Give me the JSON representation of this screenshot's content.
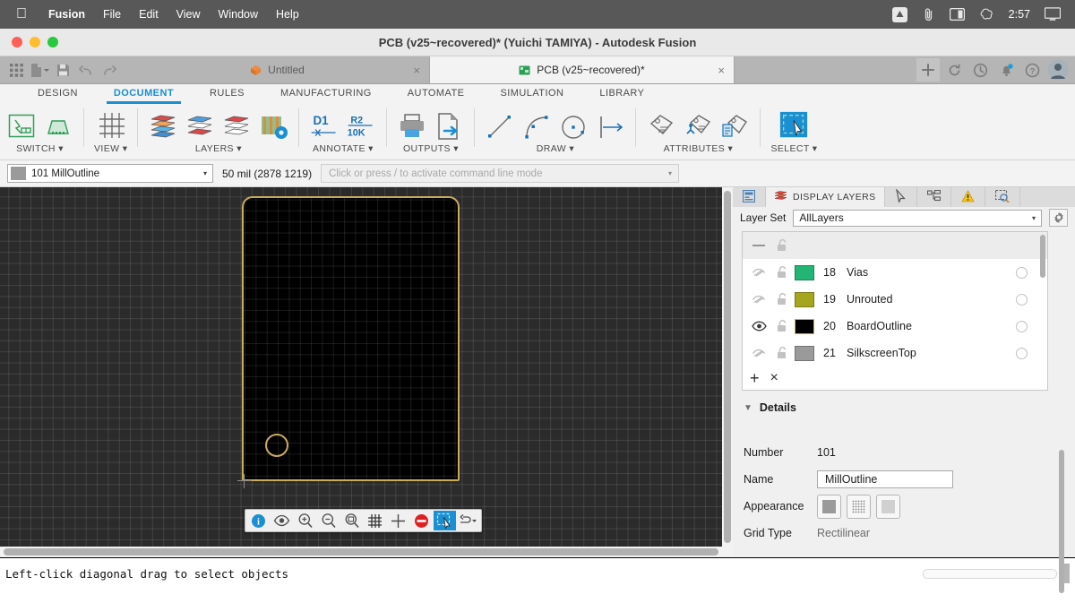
{
  "menubar": {
    "apple_icon": "apple-logo-icon",
    "items": [
      {
        "label": "Fusion",
        "bold": true
      },
      {
        "label": "File",
        "bold": false
      },
      {
        "label": "Edit",
        "bold": false
      },
      {
        "label": "View",
        "bold": false
      },
      {
        "label": "Window",
        "bold": false
      },
      {
        "label": "Help",
        "bold": false
      }
    ],
    "tray": [
      {
        "name": "dropbox-icon"
      },
      {
        "name": "paperclip-icon"
      },
      {
        "name": "split-view-icon"
      },
      {
        "name": "openai-icon"
      }
    ],
    "time": "2:57",
    "display_icon": "display-icon"
  },
  "window": {
    "title": "PCB (v25~recovered)* (Yuichi TAMIYA) - Autodesk Fusion",
    "traffic_lights": [
      "close",
      "minimize",
      "zoom"
    ]
  },
  "tabstrip": {
    "quick_tools": [
      "grid-apps-icon",
      "new-document-icon",
      "save-icon",
      "undo-icon",
      "redo-icon"
    ],
    "tabs": [
      {
        "label": "Untitled",
        "icon": "untitled-doc-icon",
        "active": false,
        "close": "×"
      },
      {
        "label": "PCB (v25~recovered)*",
        "icon": "pcb-doc-icon",
        "active": true,
        "close": "×"
      }
    ],
    "right_tools": [
      "add-tab-icon",
      "refresh-icon",
      "recent-icon",
      "notifications-icon",
      "help-icon",
      "account-avatar"
    ]
  },
  "ribbon": {
    "tabs": [
      {
        "label": "DESIGN",
        "active": false
      },
      {
        "label": "DOCUMENT",
        "active": true
      },
      {
        "label": "RULES",
        "active": false
      },
      {
        "label": "MANUFACTURING",
        "active": false
      },
      {
        "label": "AUTOMATE",
        "active": false
      },
      {
        "label": "SIMULATION",
        "active": false
      },
      {
        "label": "LIBRARY",
        "active": false
      }
    ],
    "groups": [
      {
        "label": "SWITCH ▾",
        "icons": [
          "schematic-switch-icon",
          "board-switch-icon"
        ]
      },
      {
        "label": "VIEW ▾",
        "icons": [
          "grid-view-icon"
        ]
      },
      {
        "label": "LAYERS ▾",
        "icons": [
          "layer-stack-red-icon",
          "layer-stack-blue-icon",
          "layer-stack-red2-icon",
          "layer-settings-icon"
        ]
      },
      {
        "label": "ANNOTATE ▾",
        "icons": [
          "dimension-d1-icon",
          "value-r2-10k-icon"
        ]
      },
      {
        "label": "OUTPUTS ▾",
        "icons": [
          "print-icon",
          "export-icon"
        ]
      },
      {
        "label": "DRAW ▾",
        "icons": [
          "line-icon",
          "arc-icon",
          "circle-icon",
          "dimension-icon"
        ]
      },
      {
        "label": "ATTRIBUTES ▾",
        "icons": [
          "tag-icon",
          "tag-hierarchy-icon",
          "tag-document-icon"
        ]
      },
      {
        "label": "SELECT ▾",
        "icons": [
          "select-marquee-icon"
        ]
      }
    ]
  },
  "cmdbar": {
    "layer_selector": {
      "value": "101 MillOutline",
      "swatch_color": "#9a9a9a",
      "caret": "▾"
    },
    "coordinates": "50 mil (2878 1219)",
    "command_line": {
      "placeholder": "Click or press / to activate command line mode",
      "value": "",
      "caret": "▾"
    }
  },
  "canvas": {
    "background": "#2b2b2b",
    "board_outline_color": "#c9ab5e",
    "float_toolbar": [
      {
        "name": "info-icon",
        "selected": false
      },
      {
        "name": "visibility-icon",
        "selected": false
      },
      {
        "name": "zoom-in-icon",
        "selected": false
      },
      {
        "name": "zoom-out-icon",
        "selected": false
      },
      {
        "name": "zoom-fit-icon",
        "selected": false
      },
      {
        "name": "grid-toggle-icon",
        "selected": false
      },
      {
        "name": "crosshair-icon",
        "selected": false
      },
      {
        "name": "stop-icon",
        "selected": false
      },
      {
        "name": "select-marquee-icon",
        "selected": true
      },
      {
        "name": "measure-dropdown-icon",
        "selected": false
      }
    ]
  },
  "right_panel": {
    "tabs": [
      {
        "label": "",
        "icon": "panel-layout-icon",
        "active": false
      },
      {
        "label": "DISPLAY LAYERS",
        "icon": "layers-stack-icon",
        "active": true
      },
      {
        "label": "",
        "icon": "cursor-icon",
        "active": false
      },
      {
        "label": "",
        "icon": "hierarchy-icon",
        "active": false
      },
      {
        "label": "",
        "icon": "warning-icon",
        "active": false
      },
      {
        "label": "",
        "icon": "inspect-icon",
        "active": false
      }
    ],
    "layer_set": {
      "label": "Layer Set",
      "value": "AllLayers",
      "caret": "▾",
      "settings_icon": "gear-icon"
    },
    "layers": [
      {
        "number": "",
        "name": "",
        "color": "",
        "visible": false,
        "locked": false,
        "is_header": true
      },
      {
        "number": "18",
        "name": "Vias",
        "color": "#22b573",
        "visible": false,
        "locked": false,
        "is_header": false
      },
      {
        "number": "19",
        "name": "Unrouted",
        "color": "#a5a51e",
        "visible": false,
        "locked": false,
        "is_header": false
      },
      {
        "number": "20",
        "name": "BoardOutline",
        "color": "#000000",
        "visible": true,
        "locked": false,
        "is_header": false
      },
      {
        "number": "21",
        "name": "SilkscreenTop",
        "color": "#9a9a9a",
        "visible": false,
        "locked": false,
        "is_header": false
      }
    ],
    "layer_actions": {
      "add": "+",
      "remove": "×"
    },
    "details": {
      "title": "Details",
      "collapse_icon": "▼",
      "fields": [
        {
          "key": "Number",
          "value": "101",
          "type": "text"
        },
        {
          "key": "Name",
          "value": "MillOutline",
          "type": "input"
        },
        {
          "key": "Appearance",
          "value": "",
          "type": "swatches"
        },
        {
          "key": "Grid Type",
          "value": "Rectilinear",
          "type": "text-grey"
        }
      ],
      "appearance_options": [
        "solid-swatch",
        "dotted-swatch",
        "light-swatch"
      ]
    }
  },
  "statusbar": {
    "message": "Left-click diagonal drag to select objects"
  }
}
